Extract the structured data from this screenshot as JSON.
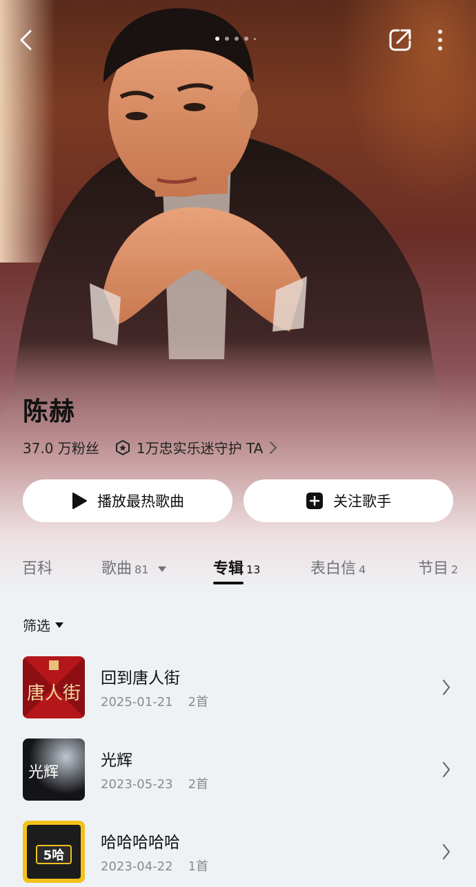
{
  "header": {
    "back_icon": "chevron-left-icon",
    "share_icon": "share-icon",
    "more_icon": "more-vertical-icon",
    "carousel_total": 5,
    "carousel_active": 1
  },
  "artist": {
    "name": "陈赫",
    "fans": "37.0 万粉丝",
    "guard_text": "1万忠实乐迷守护 TA"
  },
  "actions": {
    "play_label": "播放最热歌曲",
    "follow_label": "关注歌手"
  },
  "tabs": [
    {
      "label": "百科",
      "count": ""
    },
    {
      "label": "歌曲",
      "count": "81"
    },
    {
      "label": "专辑",
      "count": "13"
    },
    {
      "label": "表白信",
      "count": "4"
    },
    {
      "label": "节目",
      "count": "2"
    }
  ],
  "active_tab": "专辑",
  "filter": {
    "label": "筛选"
  },
  "albums": [
    {
      "title": "回到唐人街",
      "date": "2025-01-21",
      "tracks": "2首",
      "cover_text": "唐人街"
    },
    {
      "title": "光辉",
      "date": "2023-05-23",
      "tracks": "2首",
      "cover_text": "光辉"
    },
    {
      "title": "哈哈哈哈哈",
      "date": "2023-04-22",
      "tracks": "1首",
      "cover_text": "5哈"
    }
  ],
  "colors": {
    "accent": "#111111",
    "background": "#eef2f5",
    "muted": "#888c91"
  }
}
